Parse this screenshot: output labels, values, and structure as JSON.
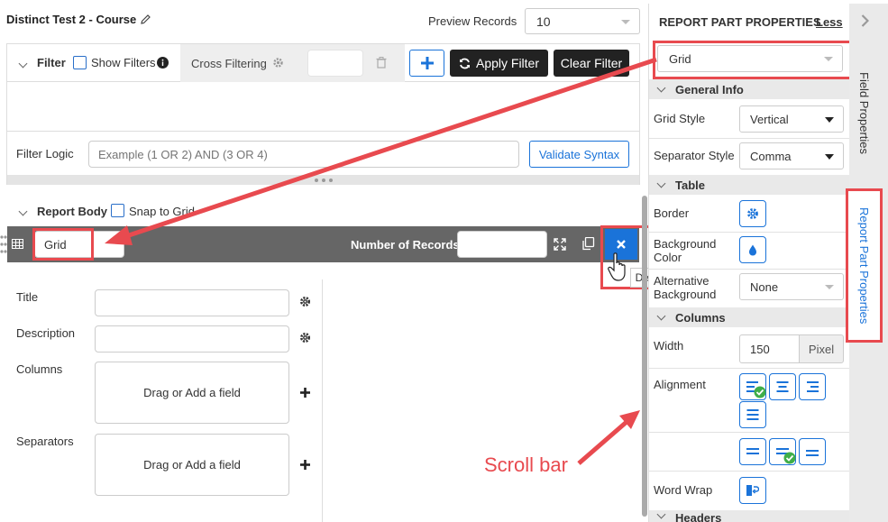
{
  "header": {
    "title": "Distinct Test 2 - Course",
    "preview_label": "Preview Records",
    "preview_value": "10"
  },
  "filter": {
    "label": "Filter",
    "show_filters_label": "Show Filters",
    "cross_filtering_label": "Cross Filtering",
    "apply_filter_label": "Apply Filter",
    "clear_filter_label": "Clear Filter",
    "filter_logic_label": "Filter Logic",
    "filter_logic_placeholder": "Example (1 OR 2) AND (3 OR 4)",
    "validate_label": "Validate Syntax"
  },
  "report_body": {
    "label": "Report Body",
    "snap_label": "Snap to Grid",
    "part_name": "Grid",
    "records_label": "Number of Records",
    "delete_tooltip": "Delete",
    "fields": {
      "title_label": "Title",
      "description_label": "Description",
      "columns_label": "Columns",
      "separators_label": "Separators",
      "drag_text": "Drag or Add a field"
    }
  },
  "annotation": {
    "scroll_bar_label": "Scroll bar",
    "color": "#e84a4f"
  },
  "properties": {
    "header_title": "REPORT PART PROPERTIES",
    "less_label": "Less",
    "part_type": "Grid",
    "general_info_label": "General Info",
    "grid_style_label": "Grid Style",
    "grid_style_value": "Vertical",
    "separator_style_label": "Separator Style",
    "separator_style_value": "Comma",
    "table_label": "Table",
    "border_label": "Border",
    "background_color_label": "Background Color",
    "alternative_background_label": "Alternative Background",
    "alternative_background_value": "None",
    "columns_label": "Columns",
    "width_label": "Width",
    "width_value": "150",
    "width_unit": "Pixel",
    "alignment_label": "Alignment",
    "word_wrap_label": "Word Wrap",
    "headers_label": "Headers"
  },
  "side_tabs": {
    "field_properties": "Field Properties",
    "report_part_properties": "Report Part Properties"
  },
  "colors": {
    "accent": "#1a73d9",
    "dark_bar": "#666666",
    "check_green": "#3fae49"
  }
}
